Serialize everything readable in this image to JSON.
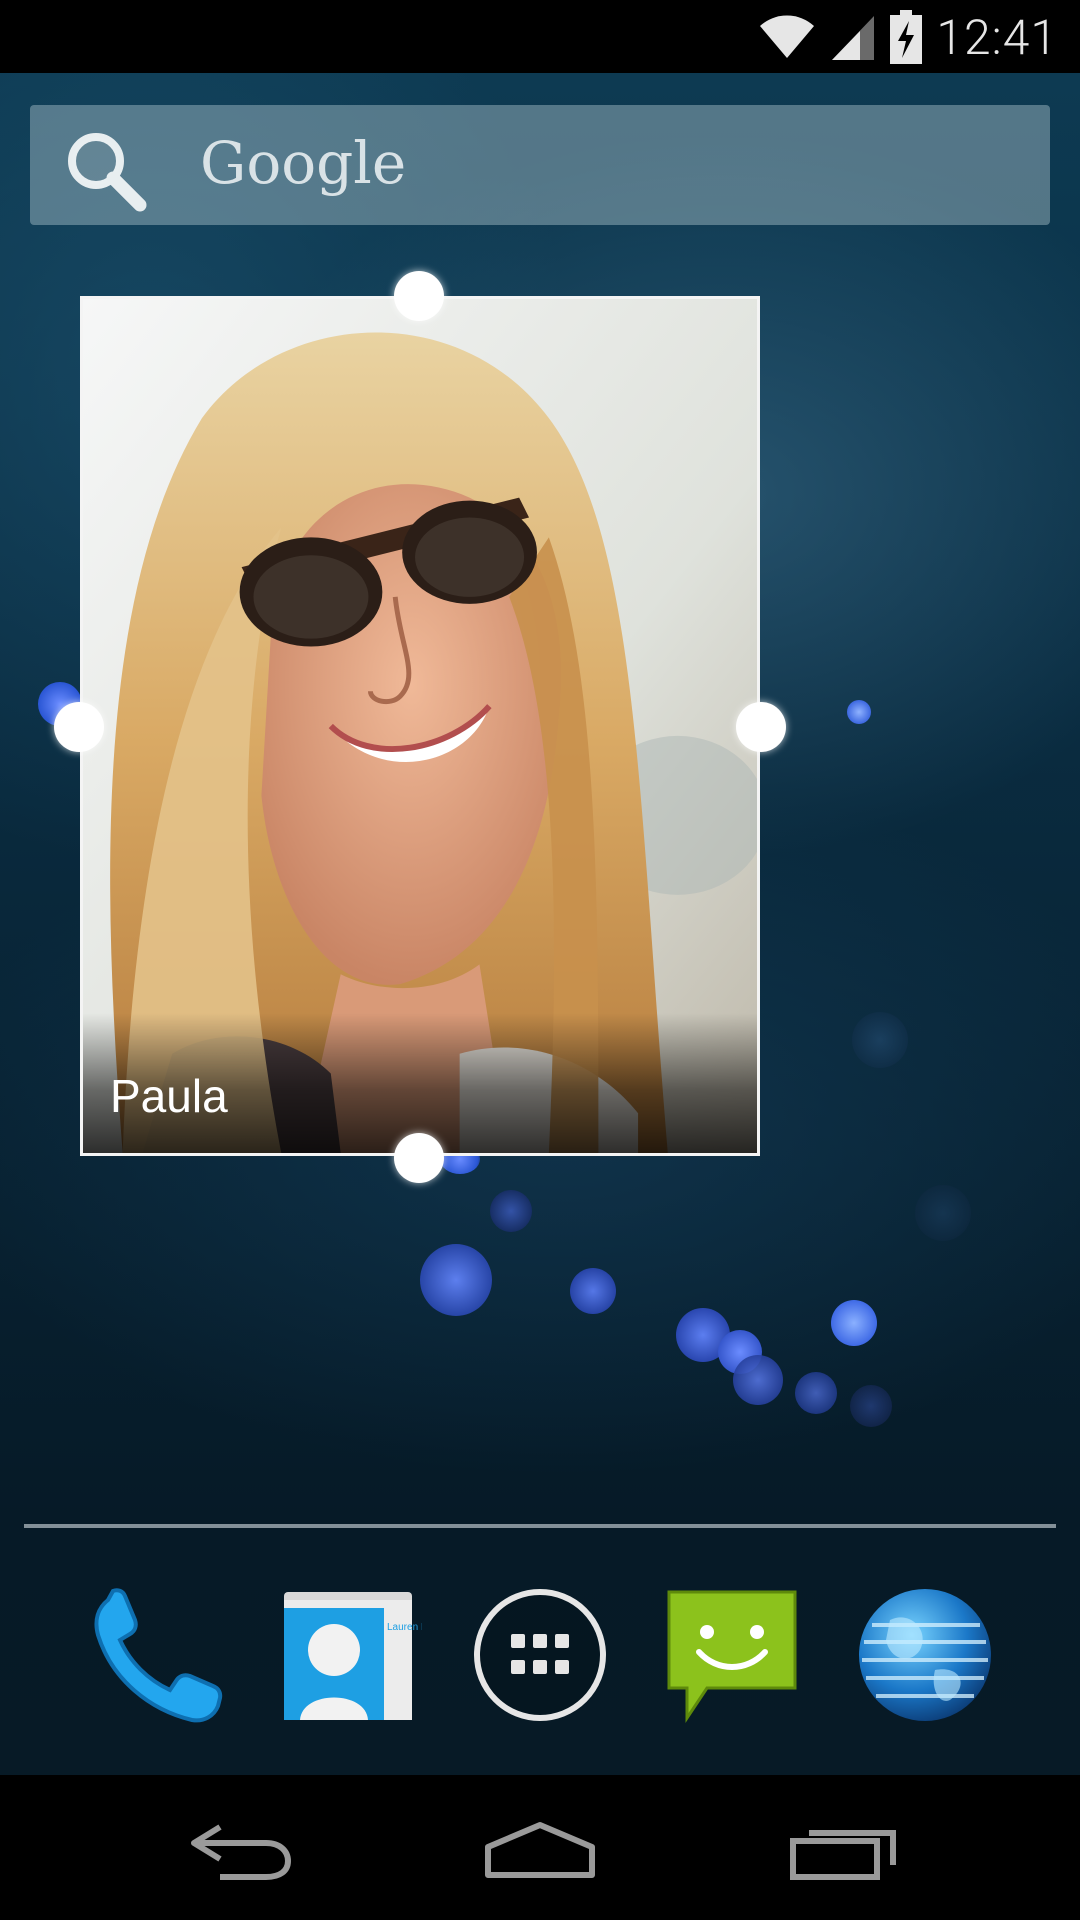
{
  "status_bar": {
    "time": "12:41",
    "icons": [
      "wifi-icon",
      "signal-icon",
      "battery-charging-icon"
    ]
  },
  "search_widget": {
    "label": "Google",
    "icon": "search-icon"
  },
  "contact_widget": {
    "name": "Paula",
    "state": "resize-mode"
  },
  "dock": {
    "apps": [
      {
        "name": "Phone",
        "icon": "phone-icon"
      },
      {
        "name": "People",
        "icon": "contacts-icon",
        "card_text": "Lauren Ipsum"
      },
      {
        "name": "Apps",
        "icon": "app-drawer-icon"
      },
      {
        "name": "Messaging",
        "icon": "messaging-icon"
      },
      {
        "name": "Browser",
        "icon": "globe-icon"
      }
    ]
  },
  "nav_bar": {
    "buttons": [
      "back-icon",
      "home-icon",
      "recents-icon"
    ]
  },
  "colors": {
    "accent_blue": "#1ea0e6",
    "message_green": "#8cc21c",
    "wallpaper_dark": "#082334"
  }
}
